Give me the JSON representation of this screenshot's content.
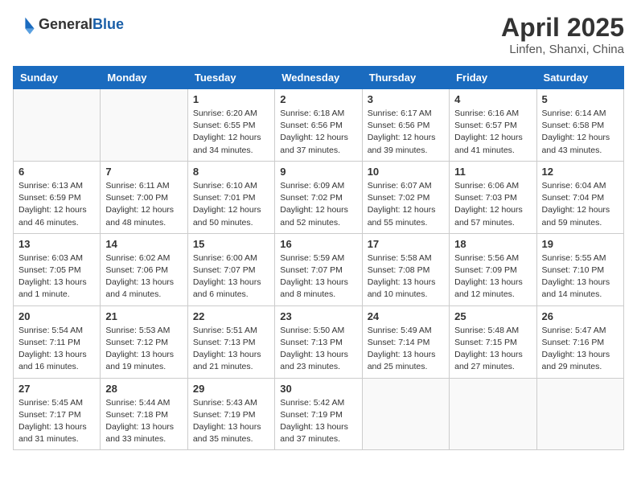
{
  "header": {
    "logo_general": "General",
    "logo_blue": "Blue",
    "title": "April 2025",
    "location": "Linfen, Shanxi, China"
  },
  "weekdays": [
    "Sunday",
    "Monday",
    "Tuesday",
    "Wednesday",
    "Thursday",
    "Friday",
    "Saturday"
  ],
  "weeks": [
    [
      {
        "day": "",
        "info": ""
      },
      {
        "day": "",
        "info": ""
      },
      {
        "day": "1",
        "info": "Sunrise: 6:20 AM\nSunset: 6:55 PM\nDaylight: 12 hours\nand 34 minutes."
      },
      {
        "day": "2",
        "info": "Sunrise: 6:18 AM\nSunset: 6:56 PM\nDaylight: 12 hours\nand 37 minutes."
      },
      {
        "day": "3",
        "info": "Sunrise: 6:17 AM\nSunset: 6:56 PM\nDaylight: 12 hours\nand 39 minutes."
      },
      {
        "day": "4",
        "info": "Sunrise: 6:16 AM\nSunset: 6:57 PM\nDaylight: 12 hours\nand 41 minutes."
      },
      {
        "day": "5",
        "info": "Sunrise: 6:14 AM\nSunset: 6:58 PM\nDaylight: 12 hours\nand 43 minutes."
      }
    ],
    [
      {
        "day": "6",
        "info": "Sunrise: 6:13 AM\nSunset: 6:59 PM\nDaylight: 12 hours\nand 46 minutes."
      },
      {
        "day": "7",
        "info": "Sunrise: 6:11 AM\nSunset: 7:00 PM\nDaylight: 12 hours\nand 48 minutes."
      },
      {
        "day": "8",
        "info": "Sunrise: 6:10 AM\nSunset: 7:01 PM\nDaylight: 12 hours\nand 50 minutes."
      },
      {
        "day": "9",
        "info": "Sunrise: 6:09 AM\nSunset: 7:02 PM\nDaylight: 12 hours\nand 52 minutes."
      },
      {
        "day": "10",
        "info": "Sunrise: 6:07 AM\nSunset: 7:02 PM\nDaylight: 12 hours\nand 55 minutes."
      },
      {
        "day": "11",
        "info": "Sunrise: 6:06 AM\nSunset: 7:03 PM\nDaylight: 12 hours\nand 57 minutes."
      },
      {
        "day": "12",
        "info": "Sunrise: 6:04 AM\nSunset: 7:04 PM\nDaylight: 12 hours\nand 59 minutes."
      }
    ],
    [
      {
        "day": "13",
        "info": "Sunrise: 6:03 AM\nSunset: 7:05 PM\nDaylight: 13 hours\nand 1 minute."
      },
      {
        "day": "14",
        "info": "Sunrise: 6:02 AM\nSunset: 7:06 PM\nDaylight: 13 hours\nand 4 minutes."
      },
      {
        "day": "15",
        "info": "Sunrise: 6:00 AM\nSunset: 7:07 PM\nDaylight: 13 hours\nand 6 minutes."
      },
      {
        "day": "16",
        "info": "Sunrise: 5:59 AM\nSunset: 7:07 PM\nDaylight: 13 hours\nand 8 minutes."
      },
      {
        "day": "17",
        "info": "Sunrise: 5:58 AM\nSunset: 7:08 PM\nDaylight: 13 hours\nand 10 minutes."
      },
      {
        "day": "18",
        "info": "Sunrise: 5:56 AM\nSunset: 7:09 PM\nDaylight: 13 hours\nand 12 minutes."
      },
      {
        "day": "19",
        "info": "Sunrise: 5:55 AM\nSunset: 7:10 PM\nDaylight: 13 hours\nand 14 minutes."
      }
    ],
    [
      {
        "day": "20",
        "info": "Sunrise: 5:54 AM\nSunset: 7:11 PM\nDaylight: 13 hours\nand 16 minutes."
      },
      {
        "day": "21",
        "info": "Sunrise: 5:53 AM\nSunset: 7:12 PM\nDaylight: 13 hours\nand 19 minutes."
      },
      {
        "day": "22",
        "info": "Sunrise: 5:51 AM\nSunset: 7:13 PM\nDaylight: 13 hours\nand 21 minutes."
      },
      {
        "day": "23",
        "info": "Sunrise: 5:50 AM\nSunset: 7:13 PM\nDaylight: 13 hours\nand 23 minutes."
      },
      {
        "day": "24",
        "info": "Sunrise: 5:49 AM\nSunset: 7:14 PM\nDaylight: 13 hours\nand 25 minutes."
      },
      {
        "day": "25",
        "info": "Sunrise: 5:48 AM\nSunset: 7:15 PM\nDaylight: 13 hours\nand 27 minutes."
      },
      {
        "day": "26",
        "info": "Sunrise: 5:47 AM\nSunset: 7:16 PM\nDaylight: 13 hours\nand 29 minutes."
      }
    ],
    [
      {
        "day": "27",
        "info": "Sunrise: 5:45 AM\nSunset: 7:17 PM\nDaylight: 13 hours\nand 31 minutes."
      },
      {
        "day": "28",
        "info": "Sunrise: 5:44 AM\nSunset: 7:18 PM\nDaylight: 13 hours\nand 33 minutes."
      },
      {
        "day": "29",
        "info": "Sunrise: 5:43 AM\nSunset: 7:19 PM\nDaylight: 13 hours\nand 35 minutes."
      },
      {
        "day": "30",
        "info": "Sunrise: 5:42 AM\nSunset: 7:19 PM\nDaylight: 13 hours\nand 37 minutes."
      },
      {
        "day": "",
        "info": ""
      },
      {
        "day": "",
        "info": ""
      },
      {
        "day": "",
        "info": ""
      }
    ]
  ]
}
